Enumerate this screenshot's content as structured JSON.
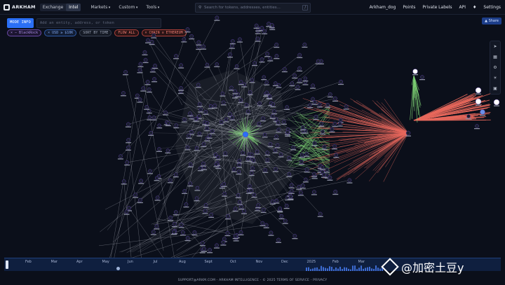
{
  "nav": {
    "brand": "ARKHAM",
    "mode_tabs": [
      "Exchange",
      "Intel"
    ],
    "active_tab": "Intel",
    "menus": [
      "Markets",
      "Custom",
      "Tools"
    ],
    "search_placeholder": "Search for tokens, addresses, entities...",
    "search_shortcut": "/",
    "user": "Arkham_dog",
    "links": [
      "Points",
      "Private Labels",
      "API"
    ],
    "translate_icon": "translate-icon",
    "settings": "Settings"
  },
  "toolbar": {
    "mode_button": "MODE INFO",
    "add_entity_placeholder": "Add an entity, address, or token",
    "share": "Share"
  },
  "filters": [
    {
      "label": "BlackRock",
      "prefix": "× —",
      "style": "p"
    },
    {
      "label": "USD ≥ $10K",
      "prefix": "×",
      "style": "b"
    },
    {
      "label": "SORT BY TIME",
      "prefix": "",
      "style": "g"
    },
    {
      "label": "FLOW ALL",
      "prefix": "",
      "style": "r"
    },
    {
      "label": "CHAIN ≡ ETHEREUM",
      "prefix": "×",
      "style": "r"
    }
  ],
  "side_tools": [
    "cursor-icon",
    "grid-icon",
    "gear-icon",
    "sun-icon",
    "lock-icon"
  ],
  "timeline": {
    "months": [
      "Feb",
      "Mar",
      "Apr",
      "May",
      "Jun",
      "Jul",
      "Aug",
      "Sept",
      "Oct",
      "Nov",
      "Dec",
      "2025",
      "Feb",
      "Mar"
    ]
  },
  "footer": "SUPPORT@ARKM.COM - ARKHAM INTELLIGENCE - © 2025 TERMS OF SERVICE - PRIVACY",
  "watermark": "@加密土豆y",
  "colors": {
    "background": "#0b0f1a",
    "accent_blue": "#2b6ff5",
    "inflow_green": "#7ccf73",
    "outflow_red": "#e8685c"
  }
}
